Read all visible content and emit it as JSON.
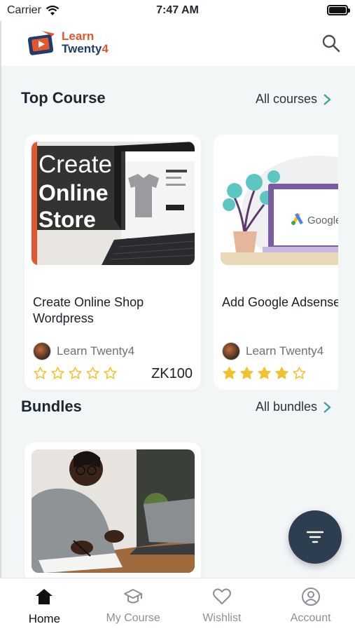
{
  "status_bar": {
    "carrier": "Carrier",
    "time": "7:47 AM"
  },
  "header": {
    "logo_line1": "Learn",
    "logo_line2": "Twenty",
    "logo_digit": "4",
    "search_icon": "search-icon"
  },
  "top_course": {
    "title": "Top Course",
    "link_label": "All courses",
    "cards": [
      {
        "thumbnail_text": [
          "Create",
          "Online",
          "Store"
        ],
        "title_line1": "Create Online Shop",
        "title_line2": "Wordpress",
        "author": "Learn Twenty4",
        "rating": 0,
        "price": "ZK100"
      },
      {
        "thumbnail_text": [
          "Google"
        ],
        "title_line1": "Add Google Adsense",
        "title_line2": "",
        "author": "Learn Twenty4",
        "rating": 4,
        "price": ""
      }
    ]
  },
  "bundles": {
    "title": "Bundles",
    "link_label": "All bundles"
  },
  "tab_bar": {
    "tabs": [
      {
        "label": "Home",
        "icon": "home-icon",
        "active": true
      },
      {
        "label": "My Course",
        "icon": "graduation-cap-icon",
        "active": false
      },
      {
        "label": "Wishlist",
        "icon": "heart-icon",
        "active": false
      },
      {
        "label": "Account",
        "icon": "account-circle-icon",
        "active": false
      }
    ]
  },
  "colors": {
    "accent": "#3aa6a0",
    "star": "#f2c12e",
    "fab": "#2c3e50",
    "logo_orange": "#e4572e",
    "logo_navy": "#1f3c6b"
  }
}
